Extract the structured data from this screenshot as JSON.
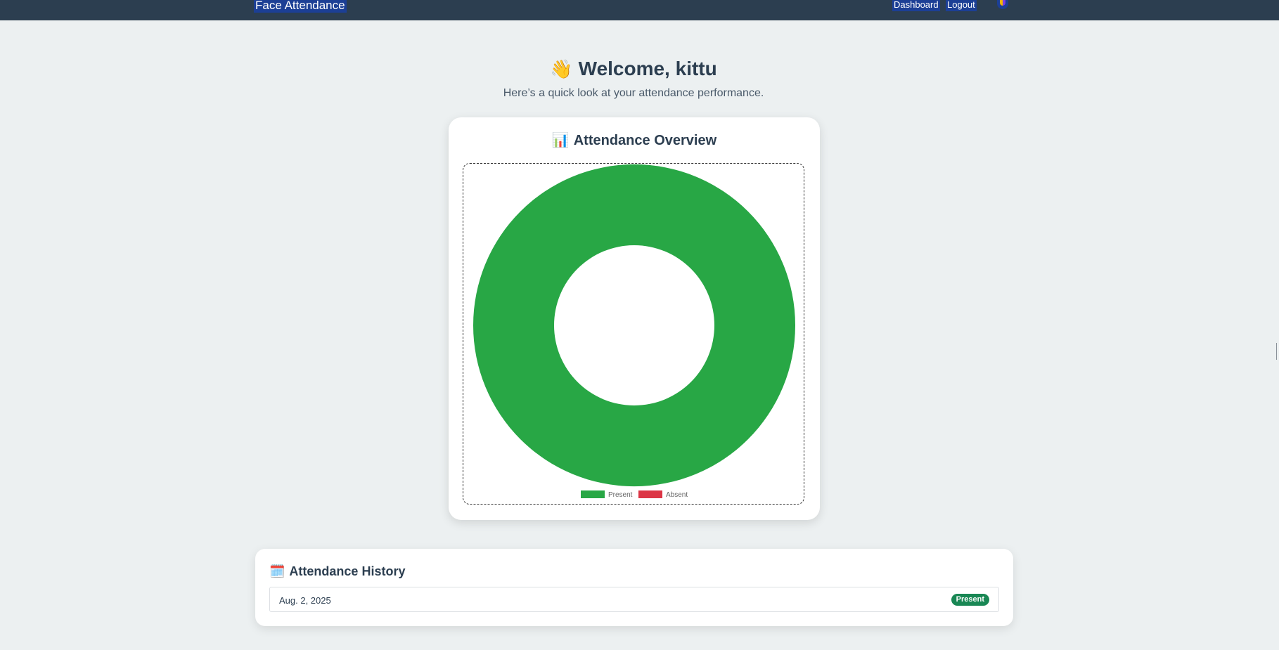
{
  "navbar": {
    "brand": "Face Attendance",
    "links": [
      "Dashboard",
      "Logout"
    ],
    "theme_toggle_icon": "theme-toggle-icon"
  },
  "welcome": {
    "icon": "waving-hand-icon",
    "emoji": "👋",
    "title": "Welcome, kittu",
    "subtitle": "Here’s a quick look at your attendance performance."
  },
  "overview": {
    "icon": "bar-chart-icon",
    "emoji": "📊",
    "title": "Attendance Overview"
  },
  "chart_data": {
    "type": "pie",
    "variant": "doughnut",
    "categories": [
      "Present",
      "Absent"
    ],
    "values": [
      1,
      0
    ],
    "colors": [
      "#28a745",
      "#dc3545"
    ],
    "legend_position": "bottom"
  },
  "history": {
    "icon": "calendar-icon",
    "emoji": "🗓️",
    "title": "Attendance History",
    "rows": [
      {
        "date": "Aug. 2, 2025",
        "status": "Present"
      }
    ]
  }
}
